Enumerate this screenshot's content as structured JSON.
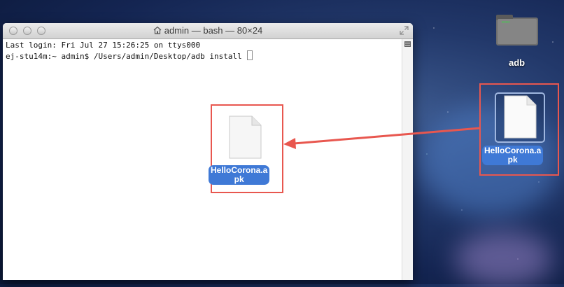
{
  "terminal": {
    "title": "admin — bash — 80×24",
    "lines": [
      "Last login: Fri Jul 27 15:26:25 on ttys000",
      "ej-stu14m:~ admin$ /Users/admin/Desktop/adb install "
    ]
  },
  "dragged_file": {
    "label_line1": "HelloCorona.a",
    "label_line2": "pk"
  },
  "desktop": {
    "folder": {
      "label": "adb",
      "folder_tag": "exec"
    },
    "file": {
      "label_line1": "HelloCorona.a",
      "label_line2": "pk"
    }
  },
  "colors": {
    "highlight": "#e8574f",
    "selection": "#3f79d6"
  }
}
